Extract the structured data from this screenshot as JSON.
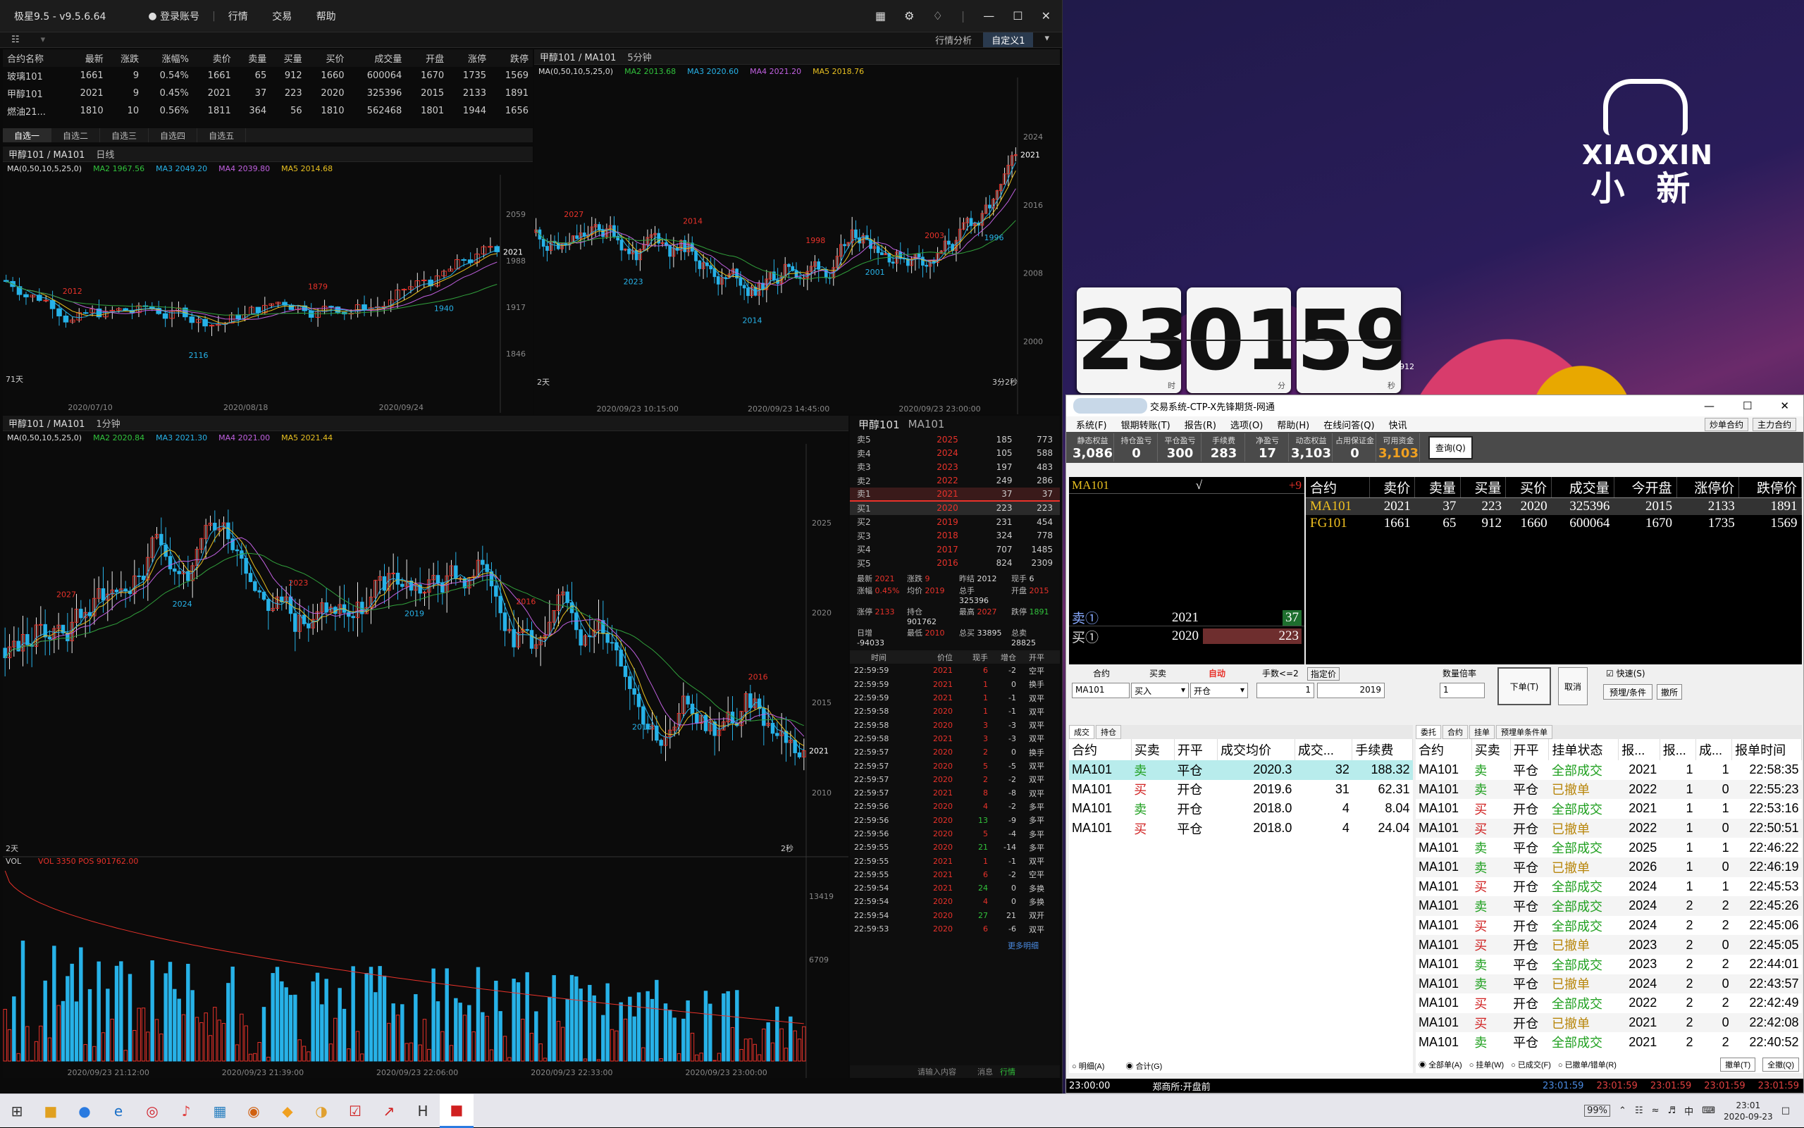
{
  "app": {
    "title": "极星9.5 - v9.5.6.64",
    "login": "登录账号",
    "menu": [
      "行情",
      "交易",
      "帮助"
    ],
    "tabs": [
      "行情分析",
      "自定义1"
    ]
  },
  "watchlist": {
    "headers": [
      "合约名称",
      "最新",
      "涨跌",
      "涨幅%",
      "卖价",
      "卖量",
      "买量",
      "买价",
      "成交量",
      "开盘",
      "涨停",
      "跌停"
    ],
    "rows": [
      [
        "玻璃101",
        "1661",
        "9",
        "0.54%",
        "1661",
        "65",
        "912",
        "1660",
        "600064",
        "1670",
        "1735",
        "1569"
      ],
      [
        "甲醇101",
        "2021",
        "9",
        "0.45%",
        "2021",
        "37",
        "223",
        "2020",
        "325396",
        "2015",
        "2133",
        "1891"
      ],
      [
        "燃油21...",
        "1810",
        "10",
        "0.56%",
        "1811",
        "364",
        "56",
        "1810",
        "562468",
        "1801",
        "1944",
        "1656"
      ]
    ],
    "tabs": [
      "自选一",
      "自选二",
      "自选三",
      "自选四",
      "自选五"
    ]
  },
  "chart_daily": {
    "title": "甲醇101 / MA101",
    "period": "日线",
    "ma_label": "MA(0,50,10,5,25,0)",
    "ma2": "MA2 1967.56",
    "ma3": "MA3 2049.20",
    "ma4": "MA4 2039.80",
    "ma5": "MA5 2014.68",
    "count": "71天",
    "x_labels": [
      "2020/07/10",
      "2020/08/18",
      "2020/09/24"
    ]
  },
  "chart_5m": {
    "title": "甲醇101 / MA101",
    "period": "5分钟",
    "ma_label": "MA(0,50,10,5,25,0)",
    "ma2": "MA2 2013.68",
    "ma3": "MA3 2020.60",
    "ma4": "MA4 2021.20",
    "ma5": "MA5 2018.76",
    "count": "2天",
    "count_r": "3分2秒",
    "x_labels": [
      "2020/09/23 10:15:00",
      "2020/09/23 14:45:00",
      "2020/09/23 23:00:00"
    ]
  },
  "chart_1m": {
    "title": "甲醇101 / MA101",
    "period": "1分钟",
    "ma_label": "MA(0,50,10,5,25,0)",
    "ma2": "MA2 2020.84",
    "ma3": "MA3 2021.30",
    "ma4": "MA4 2021.00",
    "ma5": "MA5 2021.44",
    "count": "2天",
    "count_r": "2秒",
    "vol_label": "VOL",
    "vol": "VOL 3350",
    "pos": "POS 901762.00",
    "x_labels": [
      "2020/09/23 21:12:00",
      "2020/09/23 21:39:00",
      "2020/09/23 22:06:00",
      "2020/09/23 22:33:00",
      "2020/09/23 23:00:00"
    ]
  },
  "chart_data": [
    {
      "type": "candlestick",
      "title": "甲醇101 / MA101",
      "period": "日线",
      "y_ticks": [
        "2059",
        "1988",
        "1917",
        "1846"
      ],
      "current": "2021",
      "annotations": [
        "2012",
        "2116",
        "1879",
        "1940"
      ]
    },
    {
      "type": "candlestick",
      "title": "甲醇101 / MA101",
      "period": "5分钟",
      "y_ticks": [
        "2024",
        "2016",
        "2008",
        "2000"
      ],
      "current": "2021",
      "annotations": [
        "2027",
        "2023",
        "2014",
        "2014",
        "1998",
        "2001",
        "2003",
        "1996"
      ]
    },
    {
      "type": "candlestick",
      "title": "甲醇101 / MA101",
      "period": "1分钟",
      "y_ticks": [
        "2025",
        "2020",
        "2015",
        "2010"
      ],
      "vol_ticks": [
        "13419",
        "6709"
      ],
      "current": "2021",
      "annotations": [
        "2027",
        "2024",
        "2023",
        "2019",
        "2016",
        "2016",
        "2016"
      ]
    }
  ],
  "orderbook": {
    "name": "甲醇101",
    "code": "MA101",
    "asks": [
      [
        "卖5",
        "2025",
        "185",
        "773"
      ],
      [
        "卖4",
        "2024",
        "105",
        "588"
      ],
      [
        "卖3",
        "2023",
        "197",
        "483"
      ],
      [
        "卖2",
        "2022",
        "249",
        "286"
      ],
      [
        "卖1",
        "2021",
        "37",
        "37"
      ]
    ],
    "bids": [
      [
        "买1",
        "2020",
        "223",
        "223"
      ],
      [
        "买2",
        "2019",
        "231",
        "454"
      ],
      [
        "买3",
        "2018",
        "324",
        "778"
      ],
      [
        "买4",
        "2017",
        "707",
        "1485"
      ],
      [
        "买5",
        "2016",
        "824",
        "2309"
      ]
    ],
    "stats": [
      [
        "最新",
        "2021",
        "涨跌",
        "9",
        "昨结",
        "2012"
      ],
      [
        "现手",
        "6",
        "涨幅",
        "0.45%",
        "均价",
        "2019"
      ],
      [
        "总手",
        "325396",
        "开盘",
        "2015",
        "涨停",
        "2133"
      ],
      [
        "持仓",
        "901762",
        "最高",
        "2027",
        "跌停",
        "1891"
      ],
      [
        "日增",
        "-94033",
        "最低",
        "2010",
        "",
        ""
      ],
      [
        "总买",
        "33895",
        "总卖",
        "28825",
        "",
        ""
      ]
    ],
    "tick_headers": [
      "时间",
      "价位",
      "现手",
      "增仓",
      "开平"
    ],
    "ticks": [
      [
        "22:59:59",
        "2021",
        "6",
        "-2",
        "空平"
      ],
      [
        "22:59:59",
        "2021",
        "1",
        "0",
        "换手"
      ],
      [
        "22:59:59",
        "2021",
        "1",
        "-1",
        "双平"
      ],
      [
        "22:59:58",
        "2020",
        "1",
        "-1",
        "双平"
      ],
      [
        "22:59:58",
        "2020",
        "3",
        "-3",
        "双平"
      ],
      [
        "22:59:58",
        "2021",
        "3",
        "-3",
        "双平"
      ],
      [
        "22:59:57",
        "2020",
        "2",
        "0",
        "换手"
      ],
      [
        "22:59:57",
        "2020",
        "5",
        "-5",
        "双平"
      ],
      [
        "22:59:57",
        "2020",
        "2",
        "-2",
        "双平"
      ],
      [
        "22:59:57",
        "2021",
        "8",
        "-8",
        "双平"
      ],
      [
        "22:59:56",
        "2020",
        "4",
        "-2",
        "多平"
      ],
      [
        "22:59:56",
        "2020",
        "13",
        "-9",
        "多平"
      ],
      [
        "22:59:56",
        "2020",
        "5",
        "-4",
        "多平"
      ],
      [
        "22:59:55",
        "2020",
        "21",
        "-14",
        "多平"
      ],
      [
        "22:59:55",
        "2021",
        "1",
        "-1",
        "双平"
      ],
      [
        "22:59:55",
        "2021",
        "6",
        "-2",
        "空平"
      ],
      [
        "22:59:54",
        "2021",
        "24",
        "0",
        "多换"
      ],
      [
        "22:59:54",
        "2020",
        "4",
        "0",
        "多换"
      ],
      [
        "22:59:54",
        "2020",
        "27",
        "21",
        "双开"
      ],
      [
        "22:59:53",
        "2020",
        "6",
        "-6",
        "双平"
      ]
    ],
    "more": "更多明细",
    "input_hint": "请输入内容",
    "status": [
      "消息",
      "行情"
    ]
  },
  "clock": {
    "h": "23",
    "m": "01",
    "s": "59",
    "hl": "时",
    "ml": "分",
    "sl": "秒",
    "extra": "912"
  },
  "logo": {
    "en": "XIAOXIN",
    "cn": "小 新"
  },
  "broker": {
    "title": "交易系统-CTP-X先锋期货-网通",
    "menu": [
      "系统(F)",
      "银期转账(T)",
      "报告(R)",
      "选项(O)",
      "帮助(H)",
      "在线问答(Q)",
      "快讯"
    ],
    "menu_right": [
      "炒单合约",
      "主力合约"
    ],
    "acct": [
      [
        "静态权益",
        "3,086"
      ],
      [
        "持仓盈亏",
        "0"
      ],
      [
        "平仓盈亏",
        "300"
      ],
      [
        "手续费",
        "283"
      ],
      [
        "净盈亏",
        "17"
      ],
      [
        "动态权益",
        "3,103"
      ],
      [
        "占用保证金",
        "0"
      ],
      [
        "可用资金",
        "3,103"
      ]
    ],
    "query_btn": "查询(Q)",
    "sel_contract": "MA101",
    "sel_check": "√",
    "sel_change": "+9",
    "ask_label": "卖①",
    "ask_price": "2021",
    "ask_vol": "37",
    "bid_label": "买①",
    "bid_price": "2020",
    "bid_vol": "223",
    "qheaders": [
      "合约",
      "卖价",
      "卖量",
      "买量",
      "买价",
      "成交量",
      "今开盘",
      "涨停价",
      "跌停价"
    ],
    "qrows": [
      [
        "MA101",
        "2021",
        "37",
        "223",
        "2020",
        "325396",
        "2015",
        "2133",
        "1891"
      ],
      [
        "FG101",
        "1661",
        "65",
        "912",
        "1660",
        "600064",
        "1670",
        "1735",
        "1569"
      ]
    ],
    "order": {
      "l_contract": "合约",
      "l_side": "买卖",
      "l_auto": "自动",
      "l_hands": "手数<=2",
      "l_price": "指定价",
      "contract": "MA101",
      "side": "买入",
      "offset": "开仓",
      "hands": "1",
      "price": "2019",
      "l_mult": "数量倍率",
      "mult": "1",
      "submit": "下单(T)",
      "cancel": "取消",
      "fast": "快速(S)",
      "preset": "预埋/条件",
      "reverse": "撤所"
    },
    "fills_tabs": [
      "成交",
      "持仓"
    ],
    "fills_headers": [
      "合约",
      "买卖",
      "开平",
      "成交均价",
      "成交...",
      "手续费"
    ],
    "fills": [
      [
        "MA101",
        "卖",
        "平仓",
        "2020.3",
        "32",
        "188.32"
      ],
      [
        "MA101",
        "买",
        "开仓",
        "2019.6",
        "31",
        "62.31"
      ],
      [
        "MA101",
        "卖",
        "开仓",
        "2018.0",
        "4",
        "8.04"
      ],
      [
        "MA101",
        "买",
        "平仓",
        "2018.0",
        "4",
        "24.04"
      ]
    ],
    "fills_foot": [
      "明细(A)",
      "合计(G)"
    ],
    "orders_tabs": [
      "委托",
      "合约",
      "挂单",
      "预埋单条件单"
    ],
    "orders_headers": [
      "合约",
      "买卖",
      "开平",
      "挂单状态",
      "报...",
      "报...",
      "成...",
      "报单时间"
    ],
    "orders": [
      [
        "MA101",
        "卖",
        "平仓",
        "全部成交",
        "2021",
        "1",
        "1",
        "22:58:35"
      ],
      [
        "MA101",
        "卖",
        "平仓",
        "已撤单",
        "2022",
        "1",
        "0",
        "22:55:23"
      ],
      [
        "MA101",
        "买",
        "开仓",
        "全部成交",
        "2021",
        "1",
        "1",
        "22:53:16"
      ],
      [
        "MA101",
        "买",
        "开仓",
        "已撤单",
        "2022",
        "1",
        "0",
        "22:50:51"
      ],
      [
        "MA101",
        "卖",
        "平仓",
        "全部成交",
        "2025",
        "1",
        "1",
        "22:46:22"
      ],
      [
        "MA101",
        "卖",
        "平仓",
        "已撤单",
        "2026",
        "1",
        "0",
        "22:46:19"
      ],
      [
        "MA101",
        "买",
        "开仓",
        "全部成交",
        "2024",
        "1",
        "1",
        "22:45:53"
      ],
      [
        "MA101",
        "卖",
        "平仓",
        "全部成交",
        "2024",
        "2",
        "2",
        "22:45:26"
      ],
      [
        "MA101",
        "买",
        "开仓",
        "全部成交",
        "2024",
        "2",
        "2",
        "22:45:06"
      ],
      [
        "MA101",
        "买",
        "开仓",
        "已撤单",
        "2023",
        "2",
        "0",
        "22:45:05"
      ],
      [
        "MA101",
        "卖",
        "平仓",
        "全部成交",
        "2023",
        "2",
        "2",
        "22:44:01"
      ],
      [
        "MA101",
        "卖",
        "平仓",
        "已撤单",
        "2024",
        "2",
        "0",
        "22:43:57"
      ],
      [
        "MA101",
        "买",
        "开仓",
        "全部成交",
        "2022",
        "2",
        "2",
        "22:42:49"
      ],
      [
        "MA101",
        "买",
        "开仓",
        "已撤单",
        "2021",
        "2",
        "0",
        "22:42:08"
      ],
      [
        "MA101",
        "卖",
        "平仓",
        "全部成交",
        "2021",
        "2",
        "2",
        "22:40:52"
      ]
    ],
    "orders_foot": [
      "全部单(A)",
      "挂单(W)",
      "已成交(F)",
      "已撤单/错单(R)",
      "撤单(T)",
      "全撤(Q)"
    ],
    "status_time": "23:00:00",
    "status_text": "郑商所:开盘前",
    "status_times": [
      "23:01:59",
      "23:01:59",
      "23:01:59",
      "23:01:59",
      "23:01:59"
    ]
  },
  "taskbar": {
    "battery": "99%",
    "ime": "中",
    "time": "23:01",
    "date": "2020-09-23"
  }
}
